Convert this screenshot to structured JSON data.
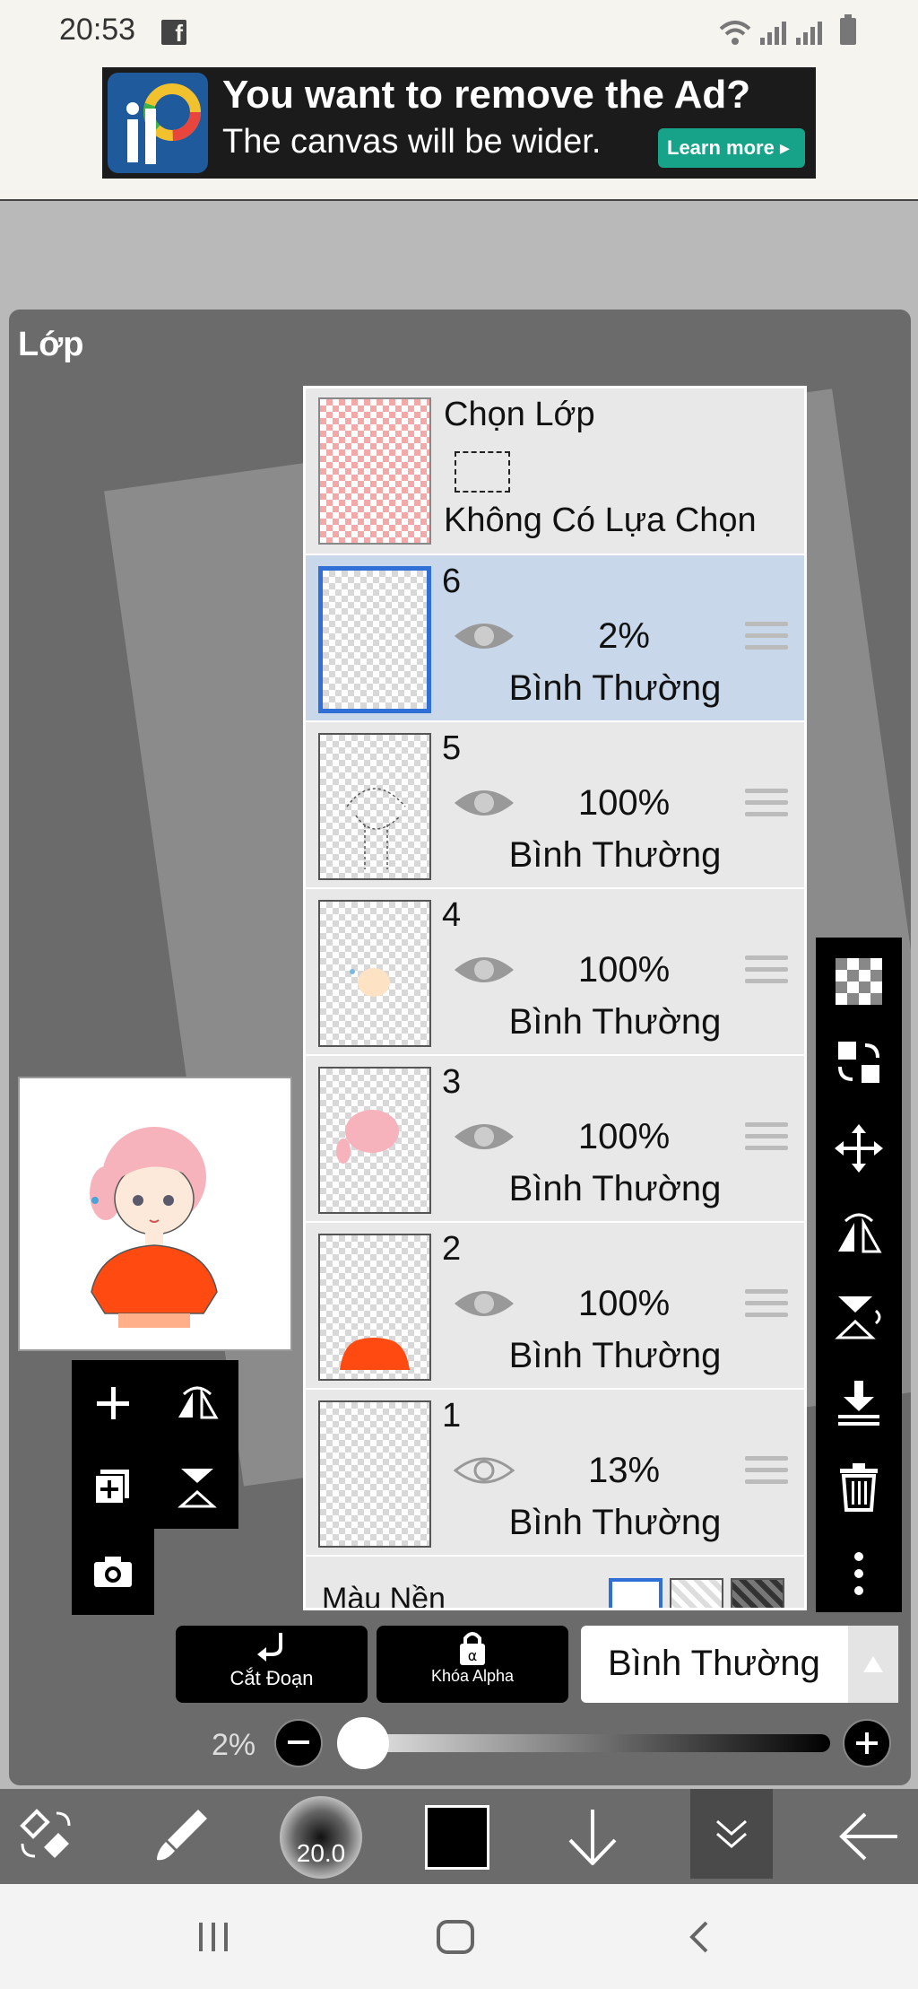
{
  "status_bar": {
    "time": "20:53",
    "fb_glyph": "f"
  },
  "ad": {
    "headline": "You want to remove the Ad?",
    "subtext": "The canvas will be wider.",
    "learn_more": "Learn more ▸"
  },
  "panel": {
    "title": "Lớp"
  },
  "selection": {
    "title": "Chọn Lớp",
    "status": "Không Có Lựa Chọn"
  },
  "layers": [
    {
      "num": "6",
      "opacity": "2%",
      "blend": "Bình Thường"
    },
    {
      "num": "5",
      "opacity": "100%",
      "blend": "Bình Thường"
    },
    {
      "num": "4",
      "opacity": "100%",
      "blend": "Bình Thường"
    },
    {
      "num": "3",
      "opacity": "100%",
      "blend": "Bình Thường"
    },
    {
      "num": "2",
      "opacity": "100%",
      "blend": "Bình Thường"
    },
    {
      "num": "1",
      "opacity": "13%",
      "blend": "Bình Thường"
    }
  ],
  "background_row": {
    "label": "Màu Nền"
  },
  "controls": {
    "clipping": "Cắt Đoạn",
    "alpha_lock": "Khóa Alpha",
    "blend_mode": "Bình Thường",
    "opacity_value": "2%",
    "brush_size": "20.0"
  },
  "colors": {
    "accent": "#2f6fd6",
    "selected_row": "#c9d7ea",
    "ad_button": "#17a389"
  }
}
